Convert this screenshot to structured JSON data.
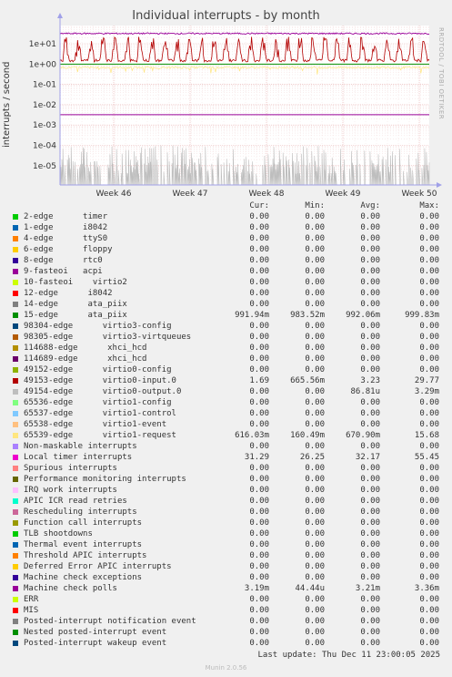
{
  "chart_data": {
    "type": "line",
    "title": "Individual interrupts - by month",
    "ylabel": "interrupts / second",
    "yscale": "log",
    "yticks": [
      "1e+01",
      "1e+00",
      "1e-01",
      "1e-02",
      "1e-03",
      "1e-04",
      "1e-05"
    ],
    "xticks": [
      "Week 46",
      "Week 47",
      "Week 48",
      "Week 49",
      "Week 50"
    ],
    "grid": true,
    "side_label": "RRDTOOL / TOBI OETIKER",
    "headers": {
      "cur": "Cur:",
      "min": "Min:",
      "avg": "Avg:",
      "max": "Max:"
    },
    "series": [
      {
        "name": "2-edge      timer",
        "color": "#00cc00",
        "cur": "0.00",
        "min": "0.00",
        "avg": "0.00",
        "max": "0.00"
      },
      {
        "name": "1-edge      i8042",
        "color": "#0066b3",
        "cur": "0.00",
        "min": "0.00",
        "avg": "0.00",
        "max": "0.00"
      },
      {
        "name": "4-edge      ttyS0",
        "color": "#ff8000",
        "cur": "0.00",
        "min": "0.00",
        "avg": "0.00",
        "max": "0.00"
      },
      {
        "name": "6-edge      floppy",
        "color": "#ffcc00",
        "cur": "0.00",
        "min": "0.00",
        "avg": "0.00",
        "max": "0.00"
      },
      {
        "name": "8-edge      rtc0",
        "color": "#330099",
        "cur": "0.00",
        "min": "0.00",
        "avg": "0.00",
        "max": "0.00"
      },
      {
        "name": "9-fasteoi   acpi",
        "color": "#990099",
        "cur": "0.00",
        "min": "0.00",
        "avg": "0.00",
        "max": "0.00"
      },
      {
        "name": "10-fasteoi    virtio2",
        "color": "#ccff00",
        "cur": "0.00",
        "min": "0.00",
        "avg": "0.00",
        "max": "0.00"
      },
      {
        "name": "12-edge      i8042",
        "color": "#ff0000",
        "cur": "0.00",
        "min": "0.00",
        "avg": "0.00",
        "max": "0.00"
      },
      {
        "name": "14-edge      ata_piix",
        "color": "#808080",
        "cur": "0.00",
        "min": "0.00",
        "avg": "0.00",
        "max": "0.00"
      },
      {
        "name": "15-edge      ata_piix",
        "color": "#008f00",
        "cur": "991.94m",
        "min": "983.52m",
        "avg": "992.06m",
        "max": "999.83m"
      },
      {
        "name": "98304-edge      virtio3-config",
        "color": "#00487d",
        "cur": "0.00",
        "min": "0.00",
        "avg": "0.00",
        "max": "0.00"
      },
      {
        "name": "98305-edge      virtio3-virtqueues",
        "color": "#b35a00",
        "cur": "0.00",
        "min": "0.00",
        "avg": "0.00",
        "max": "0.00"
      },
      {
        "name": "114688-edge      xhci_hcd",
        "color": "#b38f00",
        "cur": "0.00",
        "min": "0.00",
        "avg": "0.00",
        "max": "0.00"
      },
      {
        "name": "114689-edge      xhci_hcd",
        "color": "#6b006b",
        "cur": "0.00",
        "min": "0.00",
        "avg": "0.00",
        "max": "0.00"
      },
      {
        "name": "49152-edge      virtio0-config",
        "color": "#8fb300",
        "cur": "0.00",
        "min": "0.00",
        "avg": "0.00",
        "max": "0.00"
      },
      {
        "name": "49153-edge      virtio0-input.0",
        "color": "#b30000",
        "cur": "1.69",
        "min": "665.56m",
        "avg": "3.23",
        "max": "29.77"
      },
      {
        "name": "49154-edge      virtio0-output.0",
        "color": "#bebebe",
        "cur": "0.00",
        "min": "0.00",
        "avg": "86.81u",
        "max": "3.29m"
      },
      {
        "name": "65536-edge      virtio1-config",
        "color": "#80ff80",
        "cur": "0.00",
        "min": "0.00",
        "avg": "0.00",
        "max": "0.00"
      },
      {
        "name": "65537-edge      virtio1-control",
        "color": "#80c9ff",
        "cur": "0.00",
        "min": "0.00",
        "avg": "0.00",
        "max": "0.00"
      },
      {
        "name": "65538-edge      virtio1-event",
        "color": "#ffc080",
        "cur": "0.00",
        "min": "0.00",
        "avg": "0.00",
        "max": "0.00"
      },
      {
        "name": "65539-edge      virtio1-request",
        "color": "#ffe680",
        "cur": "616.03m",
        "min": "160.49m",
        "avg": "670.90m",
        "max": "15.68"
      },
      {
        "name": "Non-maskable interrupts",
        "color": "#aa80ff",
        "cur": "0.00",
        "min": "0.00",
        "avg": "0.00",
        "max": "0.00"
      },
      {
        "name": "Local timer interrupts",
        "color": "#ee00cc",
        "cur": "31.29",
        "min": "26.25",
        "avg": "32.17",
        "max": "55.45"
      },
      {
        "name": "Spurious interrupts",
        "color": "#ff8080",
        "cur": "0.00",
        "min": "0.00",
        "avg": "0.00",
        "max": "0.00"
      },
      {
        "name": "Performance monitoring interrupts",
        "color": "#666600",
        "cur": "0.00",
        "min": "0.00",
        "avg": "0.00",
        "max": "0.00"
      },
      {
        "name": "IRQ work interrupts",
        "color": "#ffbfff",
        "cur": "0.00",
        "min": "0.00",
        "avg": "0.00",
        "max": "0.00"
      },
      {
        "name": "APIC ICR read retries",
        "color": "#00ffcc",
        "cur": "0.00",
        "min": "0.00",
        "avg": "0.00",
        "max": "0.00"
      },
      {
        "name": "Rescheduling interrupts",
        "color": "#cc6699",
        "cur": "0.00",
        "min": "0.00",
        "avg": "0.00",
        "max": "0.00"
      },
      {
        "name": "Function call interrupts",
        "color": "#999900",
        "cur": "0.00",
        "min": "0.00",
        "avg": "0.00",
        "max": "0.00"
      },
      {
        "name": "TLB shootdowns",
        "color": "#00cc00",
        "cur": "0.00",
        "min": "0.00",
        "avg": "0.00",
        "max": "0.00"
      },
      {
        "name": "Thermal event interrupts",
        "color": "#0066b3",
        "cur": "0.00",
        "min": "0.00",
        "avg": "0.00",
        "max": "0.00"
      },
      {
        "name": "Threshold APIC interrupts",
        "color": "#ff8000",
        "cur": "0.00",
        "min": "0.00",
        "avg": "0.00",
        "max": "0.00"
      },
      {
        "name": "Deferred Error APIC interrupts",
        "color": "#ffcc00",
        "cur": "0.00",
        "min": "0.00",
        "avg": "0.00",
        "max": "0.00"
      },
      {
        "name": "Machine check exceptions",
        "color": "#330099",
        "cur": "0.00",
        "min": "0.00",
        "avg": "0.00",
        "max": "0.00"
      },
      {
        "name": "Machine check polls",
        "color": "#990099",
        "cur": "3.19m",
        "min": "44.44u",
        "avg": "3.21m",
        "max": "3.36m"
      },
      {
        "name": "ERR",
        "color": "#ccff00",
        "cur": "0.00",
        "min": "0.00",
        "avg": "0.00",
        "max": "0.00"
      },
      {
        "name": "MIS",
        "color": "#ff0000",
        "cur": "0.00",
        "min": "0.00",
        "avg": "0.00",
        "max": "0.00"
      },
      {
        "name": "Posted-interrupt notification event",
        "color": "#808080",
        "cur": "0.00",
        "min": "0.00",
        "avg": "0.00",
        "max": "0.00"
      },
      {
        "name": "Nested posted-interrupt event",
        "color": "#008f00",
        "cur": "0.00",
        "min": "0.00",
        "avg": "0.00",
        "max": "0.00"
      },
      {
        "name": "Posted-interrupt wakeup event",
        "color": "#00487d",
        "cur": "0.00",
        "min": "0.00",
        "avg": "0.00",
        "max": "0.00"
      }
    ]
  },
  "footer": {
    "last_update": "Last update: Thu Dec 11 23:00:05 2025",
    "munin": "Munin 2.0.56"
  }
}
